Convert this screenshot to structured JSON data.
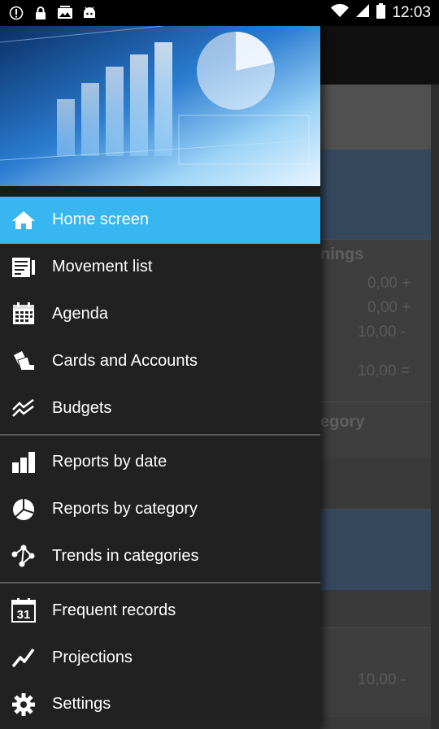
{
  "status_bar": {
    "time": "12:03",
    "left_icons": [
      "info-circle-icon",
      "lock-icon",
      "gallery-icon",
      "android-icon"
    ],
    "right_icons": [
      "wifi-icon",
      "cell-signal-icon",
      "battery-icon"
    ]
  },
  "background": {
    "section_earnings": "nings",
    "section_category": "egory",
    "values": [
      "0,00 +",
      "0,00 +",
      "10,00 -",
      "10,00 =",
      "10,00 -"
    ]
  },
  "drawer": {
    "header_image": "financial-charts-banner",
    "items": [
      {
        "label": "Home screen",
        "icon": "home-icon",
        "active": true
      },
      {
        "label": "Movement list",
        "icon": "movement-list-icon",
        "active": false
      },
      {
        "label": "Agenda",
        "icon": "calendar-icon",
        "active": false
      },
      {
        "label": "Cards and Accounts",
        "icon": "cards-icon",
        "active": false
      },
      {
        "label": "Budgets",
        "icon": "budget-trend-icon",
        "active": false
      }
    ],
    "reports": [
      {
        "label": "Reports by date",
        "icon": "bar-chart-icon"
      },
      {
        "label": "Reports by category",
        "icon": "pie-chart-icon"
      },
      {
        "label": "Trends in categories",
        "icon": "nodes-trend-icon"
      }
    ],
    "tools": [
      {
        "label": "Frequent records",
        "icon": "calendar-31-icon"
      },
      {
        "label": "Projections",
        "icon": "projection-icon"
      },
      {
        "label": "Settings",
        "icon": "gear-icon"
      }
    ],
    "colors": {
      "active": "#38b6f0",
      "background": "#212121",
      "divider": "#5a5a5a"
    }
  }
}
